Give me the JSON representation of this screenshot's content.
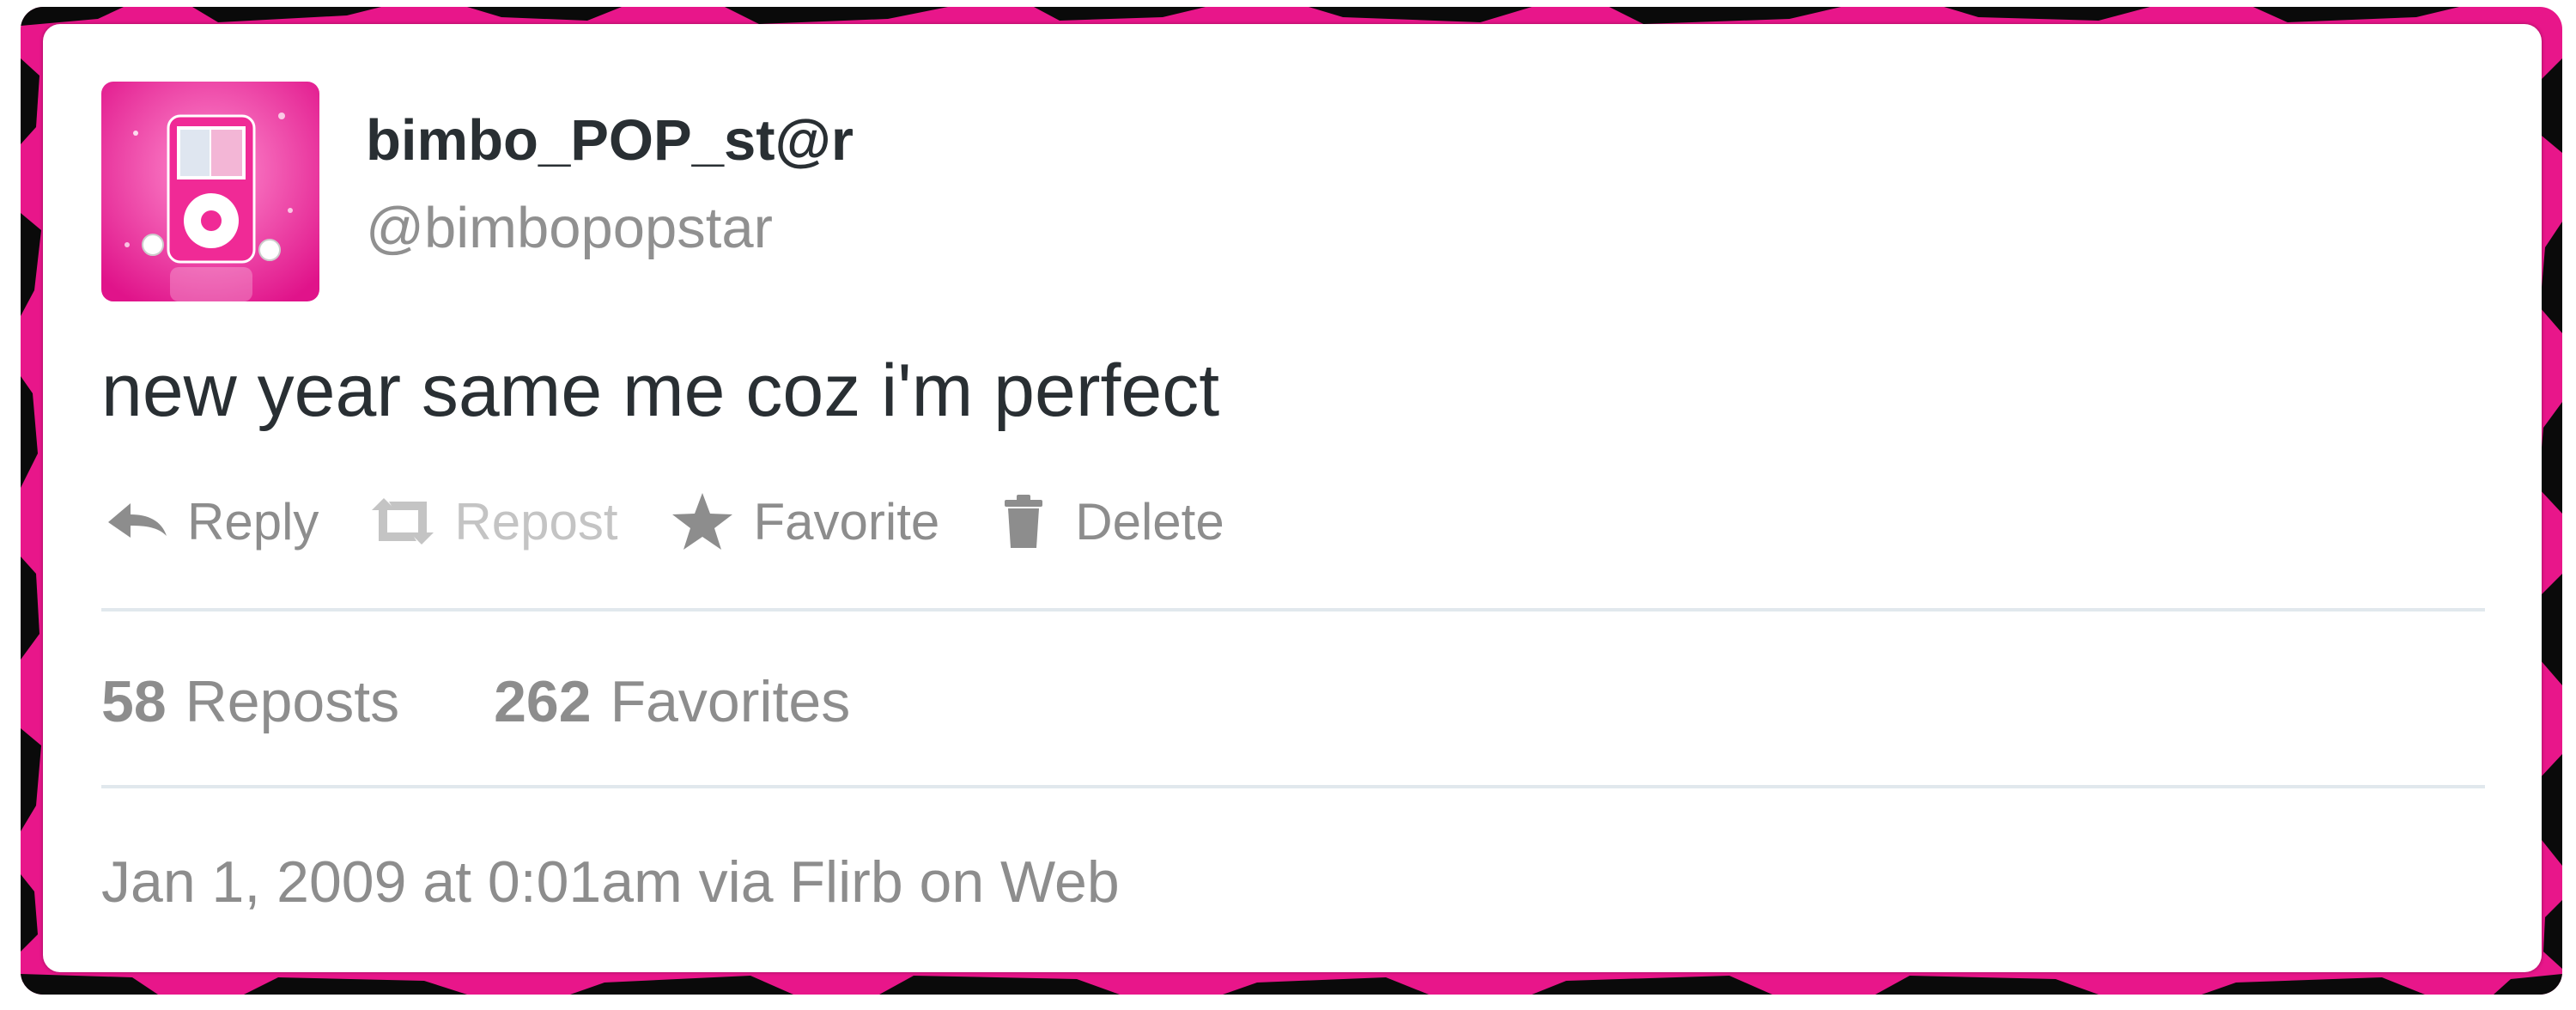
{
  "theme": {
    "frame_pink": "#e8168a",
    "frame_black": "#0a0a0a",
    "text_dark": "#292f33",
    "text_gray": "#8d8d8d",
    "text_disabled": "#c4c4c4",
    "divider": "#e1e8ed"
  },
  "user": {
    "display_name": "bimbo_POP_st@r",
    "handle": "@bimbopopstar",
    "avatar_icon": "pink-mp3-player-avatar"
  },
  "tweet": {
    "text": "new year same me coz i'm perfect"
  },
  "actions": [
    {
      "label": "Reply",
      "icon": "reply-icon",
      "enabled": true
    },
    {
      "label": "Repost",
      "icon": "repost-icon",
      "enabled": false
    },
    {
      "label": "Favorite",
      "icon": "star-icon",
      "enabled": true
    },
    {
      "label": "Delete",
      "icon": "trash-icon",
      "enabled": true
    }
  ],
  "stats": {
    "reposts_count": "58",
    "reposts_label": "Reposts",
    "favorites_count": "262",
    "favorites_label": "Favorites"
  },
  "meta": {
    "timestamp": "Jan 1, 2009 at 0:01am via Flirb on Web"
  }
}
